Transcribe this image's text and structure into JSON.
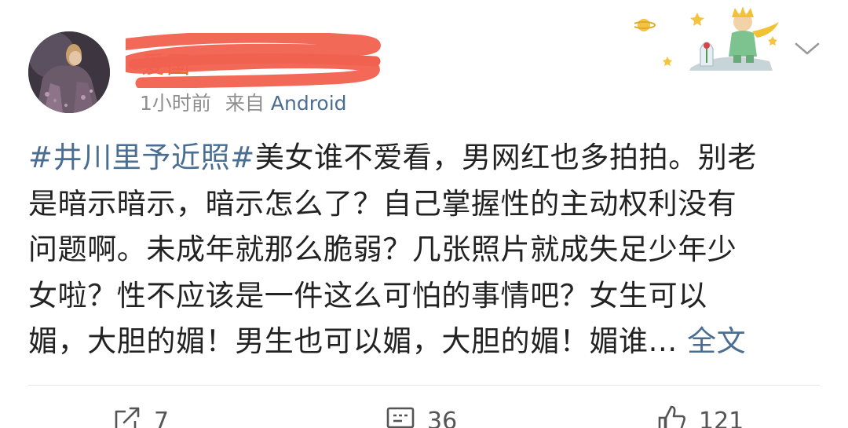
{
  "post": {
    "username": "爱国",
    "time": "1小时前",
    "source_prefix": "来自",
    "source": "Android",
    "text_lines": [
      {
        "hashtag": "#井川里予近照#",
        "text": "美女谁不爱看，男网红也多拍拍。别老"
      },
      {
        "text": "是暗示暗示，暗示怎么了？自己掌握性的主动权利没有"
      },
      {
        "text": "问题啊。未成年就那么脆弱？几张照片就成失足少年少"
      },
      {
        "text": "女啦？性不应该是一件这么可怕的事情吧？女生可以"
      },
      {
        "text": "媚，大胆的媚！男生也可以媚，大胆的媚！媚谁...",
        "more": "全文"
      }
    ]
  },
  "actions": {
    "repost_count": "7",
    "comment_count": "36",
    "like_count": "121"
  },
  "icons": {
    "menu": "chevron-down-icon",
    "repost": "repost-icon",
    "comment": "comment-icon",
    "like": "thumbs-up-icon",
    "decor": "little-prince-decoration"
  },
  "colors": {
    "link": "#4a6d92",
    "text": "#222222",
    "meta": "#8e8e8e",
    "redaction": "#f1614f"
  }
}
